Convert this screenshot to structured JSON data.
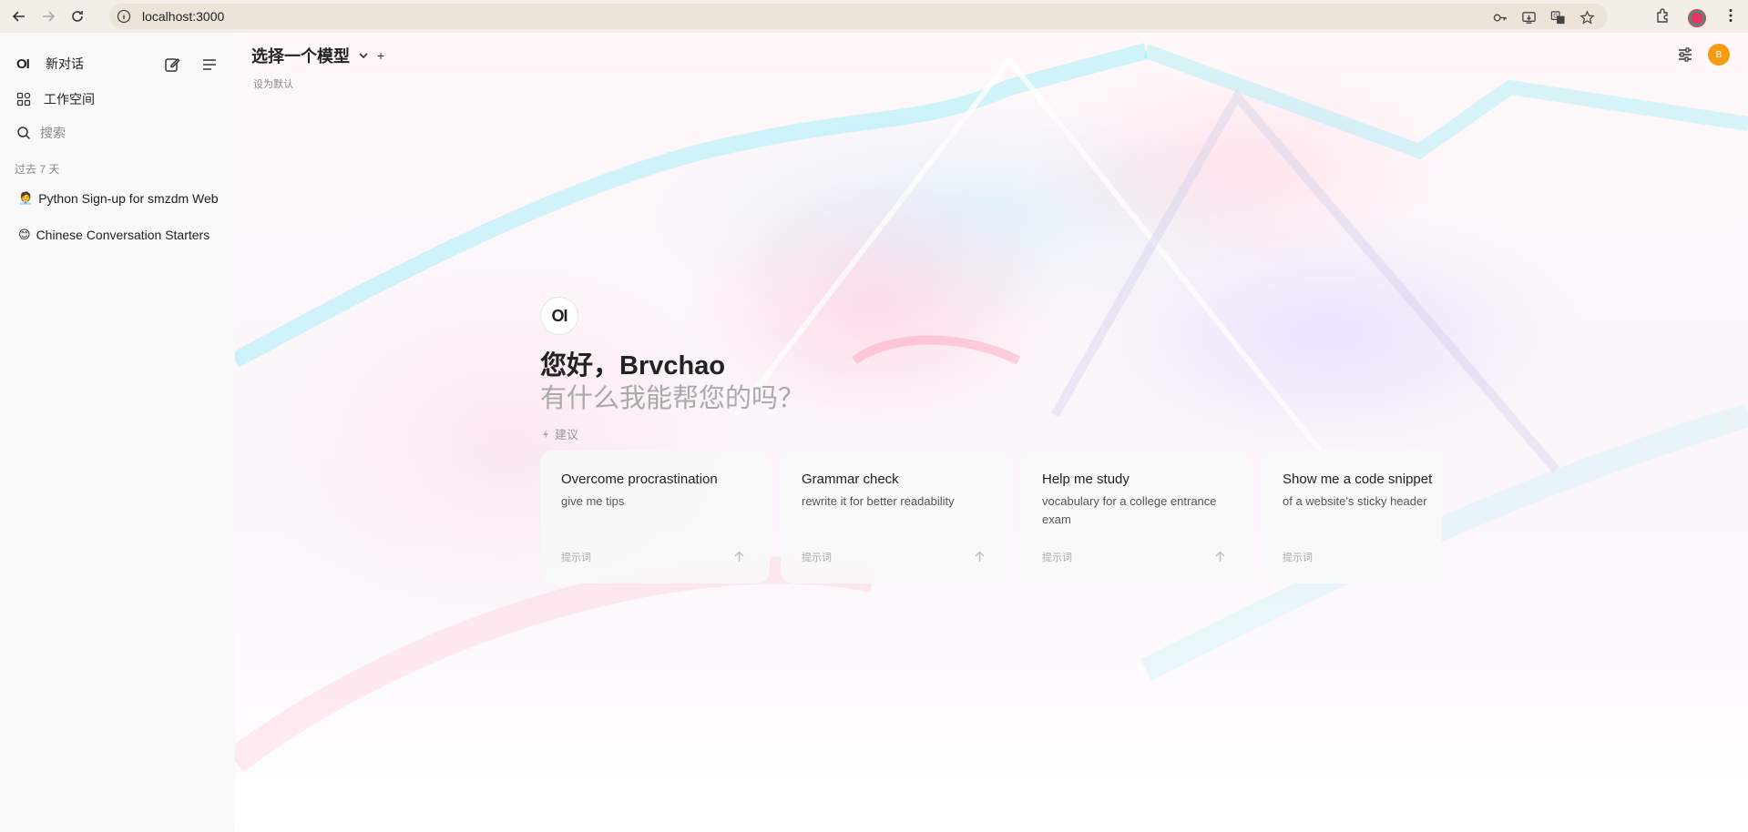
{
  "browser": {
    "url": "localhost:3000"
  },
  "sidebar": {
    "logo": "OI",
    "new_chat": "新对话",
    "workspace": "工作空间",
    "search_placeholder": "搜索",
    "section_label": "过去 7 天",
    "chats": [
      {
        "emoji": "🧑‍💼",
        "title": "Python Sign-up for smzdm Website"
      },
      {
        "emoji": "😊",
        "title": "Chinese Conversation Starters"
      }
    ]
  },
  "header": {
    "model_title": "选择一个模型",
    "set_default": "设为默认",
    "avatar_initial": "B"
  },
  "hero": {
    "logo": "OI",
    "greeting": "您好，Brvchao",
    "subtitle": "有什么我能帮您的吗？",
    "suggest_label": "建议"
  },
  "cards": [
    {
      "title": "Overcome procrastination",
      "desc": "give me tips",
      "tag": "提示词"
    },
    {
      "title": "Grammar check",
      "desc": "rewrite it for better readability",
      "tag": "提示词"
    },
    {
      "title": "Help me study",
      "desc": "vocabulary for a college entrance exam",
      "tag": "提示词"
    },
    {
      "title": "Show me a code snippet",
      "desc": "of a website's sticky header",
      "tag": "提示词"
    }
  ]
}
